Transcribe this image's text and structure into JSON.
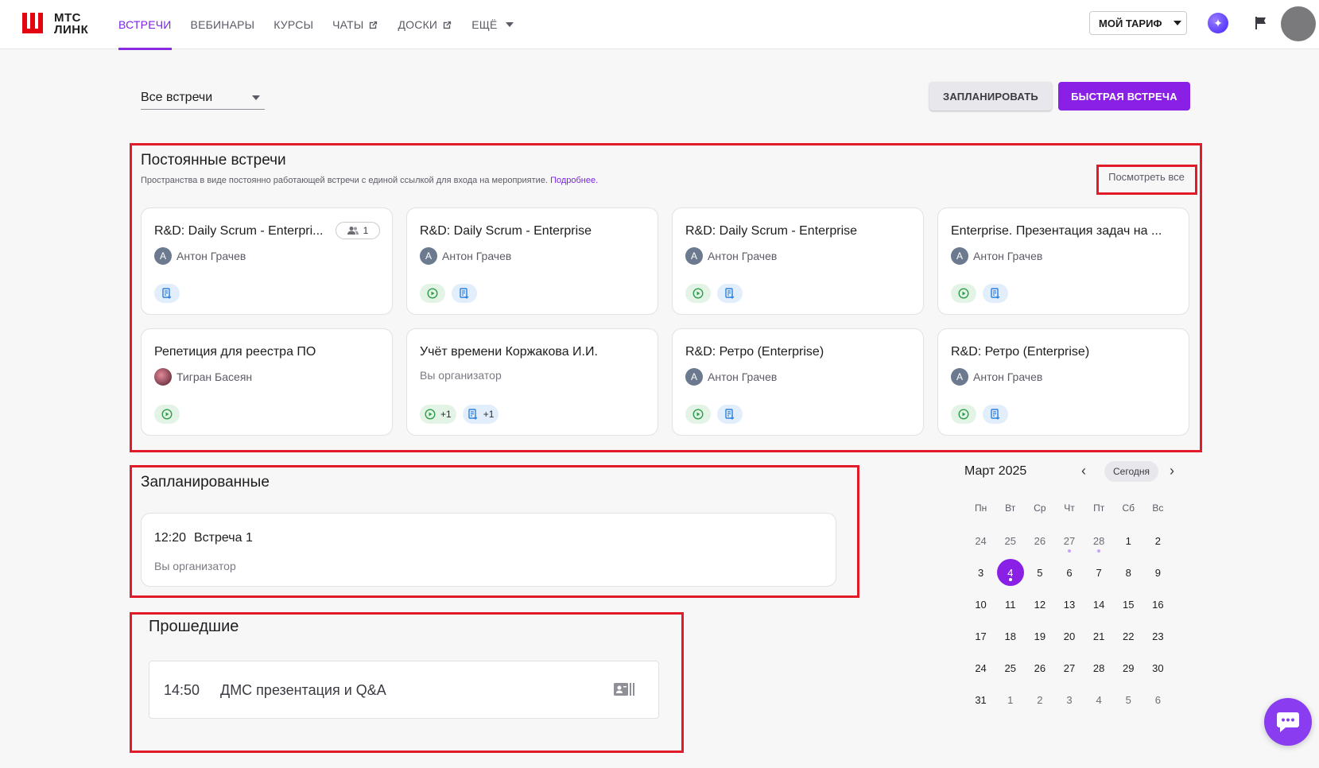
{
  "header": {
    "logo_line1": "МТС",
    "logo_line2": "ЛИНК",
    "nav": [
      {
        "label": "ВСТРЕЧИ",
        "active": true
      },
      {
        "label": "ВЕБИНАРЫ"
      },
      {
        "label": "КУРСЫ"
      },
      {
        "label": "ЧАТЫ",
        "external": true
      },
      {
        "label": "ДОСКИ",
        "external": true
      },
      {
        "label": "ЕЩЁ",
        "dropdown": true
      }
    ],
    "tariff_label": "МОЙ ТАРИФ"
  },
  "toolbar": {
    "filter_value": "Все встречи",
    "plan_label": "ЗАПЛАНИРОВАТЬ",
    "quick_label": "БЫСТРАЯ ВСТРЕЧА"
  },
  "permanent": {
    "title": "Постоянные встречи",
    "subtitle": "Пространства в виде постоянно работающей встречи с единой ссылкой для входа на мероприятие.",
    "more_link": "Подробнее.",
    "see_all": "Посмотреть все",
    "cards": [
      {
        "title": "R&D: Daily Scrum - Enterpri...",
        "person": "Антон Грачев",
        "initial": "А",
        "members": "1"
      },
      {
        "title": "R&D: Daily Scrum - Enterprise",
        "person": "Антон Грачев",
        "initial": "А"
      },
      {
        "title": "R&D: Daily Scrum - Enterprise",
        "person": "Антон Грачев",
        "initial": "А"
      },
      {
        "title": "Enterprise. Презентация задач на ...",
        "person": "Антон Грачев",
        "initial": "А"
      },
      {
        "title": "Репетиция для реестра ПО",
        "person": "Тигран Басеян"
      },
      {
        "title": "Учёт времени Коржакова И.И.",
        "organizer": "Вы организатор",
        "play_extra": "+1",
        "doc_extra": "+1"
      },
      {
        "title": "R&D: Ретро (Enterprise)",
        "person": "Антон Грачев",
        "initial": "А"
      },
      {
        "title": "R&D: Ретро (Enterprise)",
        "person": "Антон Грачев",
        "initial": "А"
      }
    ]
  },
  "scheduled": {
    "title": "Запланированные",
    "item": {
      "time": "12:20",
      "name": "Встреча 1",
      "organizer": "Вы организатор"
    }
  },
  "past": {
    "title": "Прошедшие",
    "item": {
      "time": "14:50",
      "name": "ДМС презентация и Q&A"
    }
  },
  "calendar": {
    "month": "Март 2025",
    "today_label": "Сегодня",
    "weekdays": [
      "Пн",
      "Вт",
      "Ср",
      "Чт",
      "Пт",
      "Сб",
      "Вс"
    ],
    "weeks": [
      [
        "24",
        "25",
        "26",
        "27",
        "28",
        "1",
        "2"
      ],
      [
        "3",
        "4",
        "5",
        "6",
        "7",
        "8",
        "9"
      ],
      [
        "10",
        "11",
        "12",
        "13",
        "14",
        "15",
        "16"
      ],
      [
        "17",
        "18",
        "19",
        "20",
        "21",
        "22",
        "23"
      ],
      [
        "24",
        "25",
        "26",
        "27",
        "28",
        "29",
        "30"
      ],
      [
        "31",
        "1",
        "2",
        "3",
        "4",
        "5",
        "6"
      ]
    ],
    "selected": "4"
  },
  "colors": {
    "accent": "#8a1fe6",
    "highlight": "#e21b2b"
  }
}
